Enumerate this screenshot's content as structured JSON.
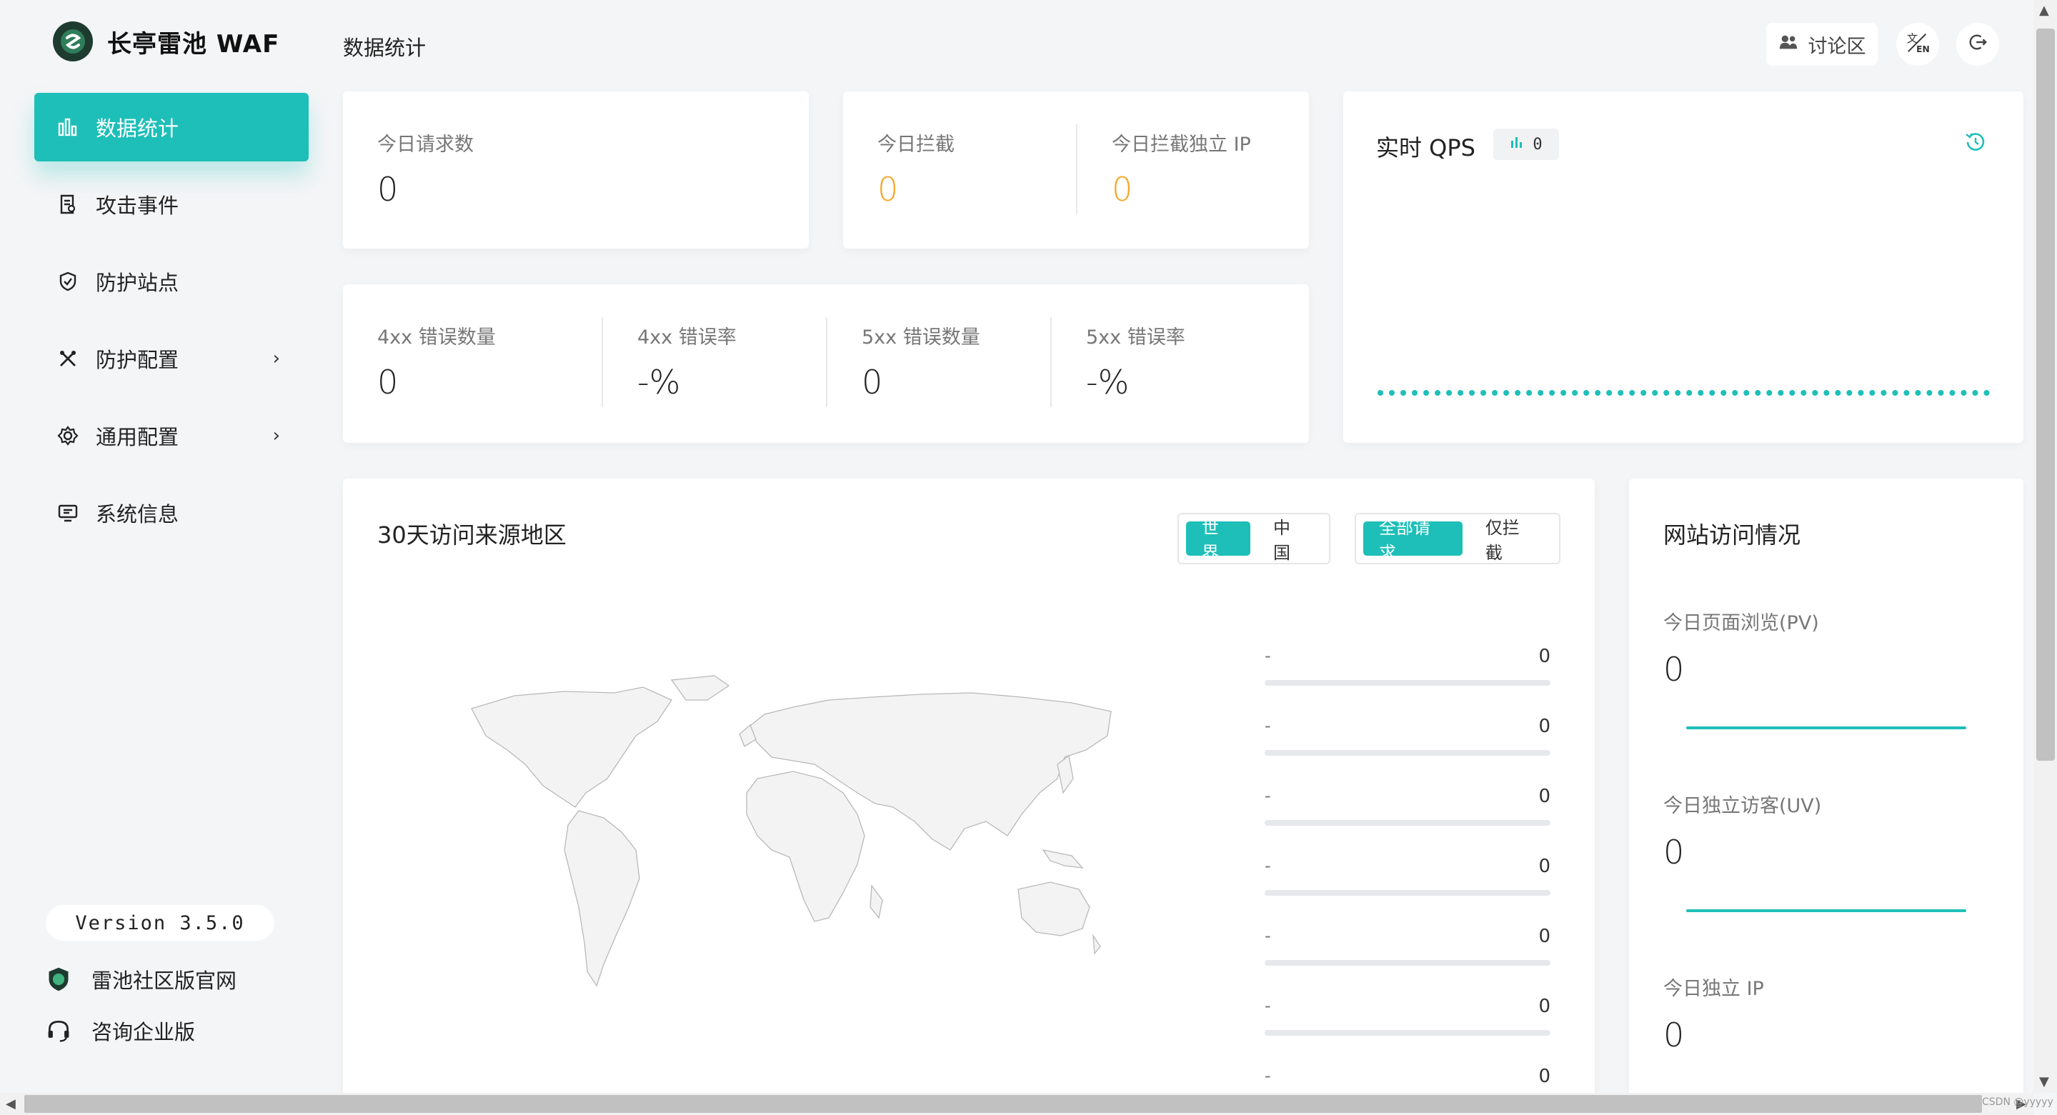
{
  "app": {
    "name": "长亭雷池 WAF",
    "version": "Version 3.5.0"
  },
  "sidebar": {
    "items": [
      {
        "label": "数据统计",
        "icon": "bar-chart-icon",
        "active": true
      },
      {
        "label": "攻击事件",
        "icon": "document-icon"
      },
      {
        "label": "防护站点",
        "icon": "shield-icon"
      },
      {
        "label": "防护配置",
        "icon": "tools-icon",
        "chevron": "›"
      },
      {
        "label": "通用配置",
        "icon": "gear-icon",
        "chevron": "›"
      },
      {
        "label": "系统信息",
        "icon": "monitor-icon"
      }
    ],
    "links": [
      {
        "label": "雷池社区版官网",
        "icon": "shield-logo-icon"
      },
      {
        "label": "咨询企业版",
        "icon": "headset-icon"
      }
    ]
  },
  "header": {
    "title": "数据统计",
    "forum_label": "讨论区"
  },
  "stats": {
    "today_requests": {
      "label": "今日请求数",
      "value": "0"
    },
    "today_blocked": {
      "label": "今日拦截",
      "value": "0"
    },
    "today_blocked_ip": {
      "label": "今日拦截独立 IP",
      "value": "0"
    },
    "err4xx_count": {
      "label": "4xx 错误数量",
      "value": "0"
    },
    "err4xx_rate": {
      "label": "4xx 错误率",
      "value": "-%"
    },
    "err5xx_count": {
      "label": "5xx 错误数量",
      "value": "0"
    },
    "err5xx_rate": {
      "label": "5xx 错误率",
      "value": "-%"
    }
  },
  "qps": {
    "title": "实时 QPS",
    "value": "0",
    "accent": "#1dbfb8"
  },
  "geo": {
    "title": "30天访问来源地区",
    "region_tabs": [
      "世界",
      "中国"
    ],
    "filter_tabs": [
      "全部请求",
      "仅拦截"
    ],
    "rows": [
      {
        "name": "-",
        "value": "0"
      },
      {
        "name": "-",
        "value": "0"
      },
      {
        "name": "-",
        "value": "0"
      },
      {
        "name": "-",
        "value": "0"
      },
      {
        "name": "-",
        "value": "0"
      },
      {
        "name": "-",
        "value": "0"
      },
      {
        "name": "-",
        "value": "0"
      }
    ]
  },
  "visits": {
    "title": "网站访问情况",
    "pv": {
      "label": "今日页面浏览(PV)",
      "value": "0"
    },
    "uv": {
      "label": "今日独立访客(UV)",
      "value": "0"
    },
    "ip": {
      "label": "今日独立 IP",
      "value": "0"
    }
  },
  "watermark": "CSDN @yyyyy"
}
